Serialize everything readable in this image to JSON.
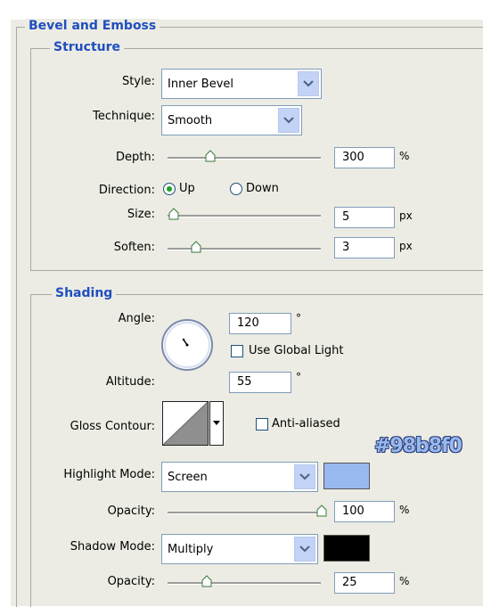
{
  "section": {
    "title": "Bevel and Emboss"
  },
  "structure": {
    "title": "Structure",
    "style": {
      "label": "Style:",
      "value": "Inner Bevel"
    },
    "technique": {
      "label": "Technique:",
      "value": "Smooth"
    },
    "depth": {
      "label": "Depth:",
      "value": "300",
      "unit": "%",
      "slider_level": 0.26
    },
    "direction": {
      "label": "Direction:",
      "options": [
        "Up",
        "Down"
      ],
      "selected": "Up"
    },
    "size": {
      "label": "Size:",
      "value": "5",
      "unit": "px",
      "slider_level": 0.0
    },
    "soften": {
      "label": "Soften:",
      "value": "3",
      "unit": "px",
      "slider_level": 0.18
    }
  },
  "shading": {
    "title": "Shading",
    "angle": {
      "label": "Angle:",
      "value": "120",
      "unit": "°"
    },
    "use_global_light": {
      "label": "Use Global Light",
      "checked": false
    },
    "altitude": {
      "label": "Altitude:",
      "value": "55",
      "unit": "°"
    },
    "gloss_contour": {
      "label": "Gloss Contour:"
    },
    "anti_aliased": {
      "label": "Anti-aliased",
      "checked": false
    },
    "hex_annotation": "#98b8f0",
    "highlight_mode": {
      "label": "Highlight Mode:",
      "value": "Screen",
      "color": "#98b8f0"
    },
    "highlight_opacity": {
      "label": "Opacity:",
      "value": "100",
      "unit": "%",
      "slider_level": 1.0
    },
    "shadow_mode": {
      "label": "Shadow Mode:",
      "value": "Multiply",
      "color": "#000000"
    },
    "shadow_opacity": {
      "label": "Opacity:",
      "value": "25",
      "unit": "%",
      "slider_level": 0.25
    }
  },
  "colors": {
    "accent_title": "#1f4fbf",
    "dropdown_arrow_bg": "#c3d3f7",
    "panel_bg": "#ecece4"
  }
}
